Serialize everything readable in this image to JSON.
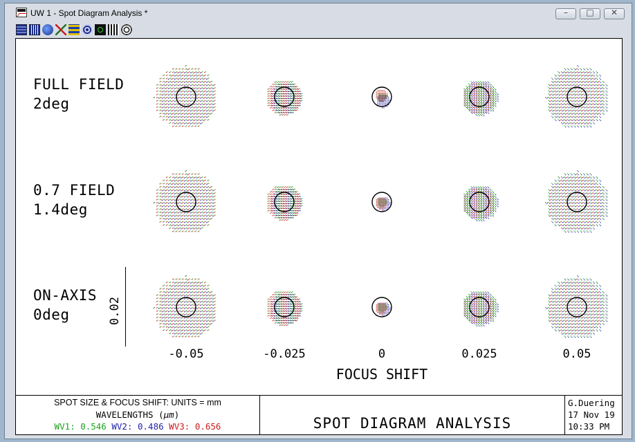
{
  "window": {
    "title": "UW 1 - Spot Diagram Analysis *",
    "buttons": {
      "minimize": "–",
      "maximize": "□",
      "close": "✕"
    }
  },
  "toolbar": {
    "icons": [
      "surface-data-icon",
      "layout-icon",
      "globe-icon",
      "ray-fan-icon",
      "mtf-icon",
      "psf-icon",
      "spot-icon",
      "grid-icon",
      "settings-icon"
    ]
  },
  "plot": {
    "rows": [
      {
        "line1": "FULL FIELD",
        "line2": "2deg"
      },
      {
        "line1": "0.7 FIELD",
        "line2": "1.4deg"
      },
      {
        "line1": "ON-AXIS",
        "line2": "0deg"
      }
    ],
    "focus_shifts": [
      "-0.05",
      "-0.025",
      "0",
      "0.025",
      "0.05"
    ],
    "axis_title": "FOCUS SHIFT",
    "scale_label": "0.02"
  },
  "footer": {
    "units_line": "SPOT SIZE & FOCUS SHIFT: UNITS = mm",
    "wavelengths_prefix": "WAVELENGTHS (",
    "wavelengths_unit": "μm",
    "wavelengths_suffix": ")",
    "wavelengths": [
      {
        "label": "WV1: ",
        "value": "0.546",
        "color": "#1aa31a"
      },
      {
        "label": "WV2: ",
        "value": "0.486",
        "color": "#1f1fa8"
      },
      {
        "label": "WV3: ",
        "value": "0.656",
        "color": "#cc1a1a"
      }
    ],
    "title": "SPOT DIAGRAM ANALYSIS",
    "author": "G.Duering",
    "date": "17 Nov 19",
    "time": "10:33 PM"
  },
  "colors": {
    "wv1": "#1aa31a",
    "wv2": "#1f1fa8",
    "wv3": "#cc1a1a",
    "axis": "#000000"
  }
}
